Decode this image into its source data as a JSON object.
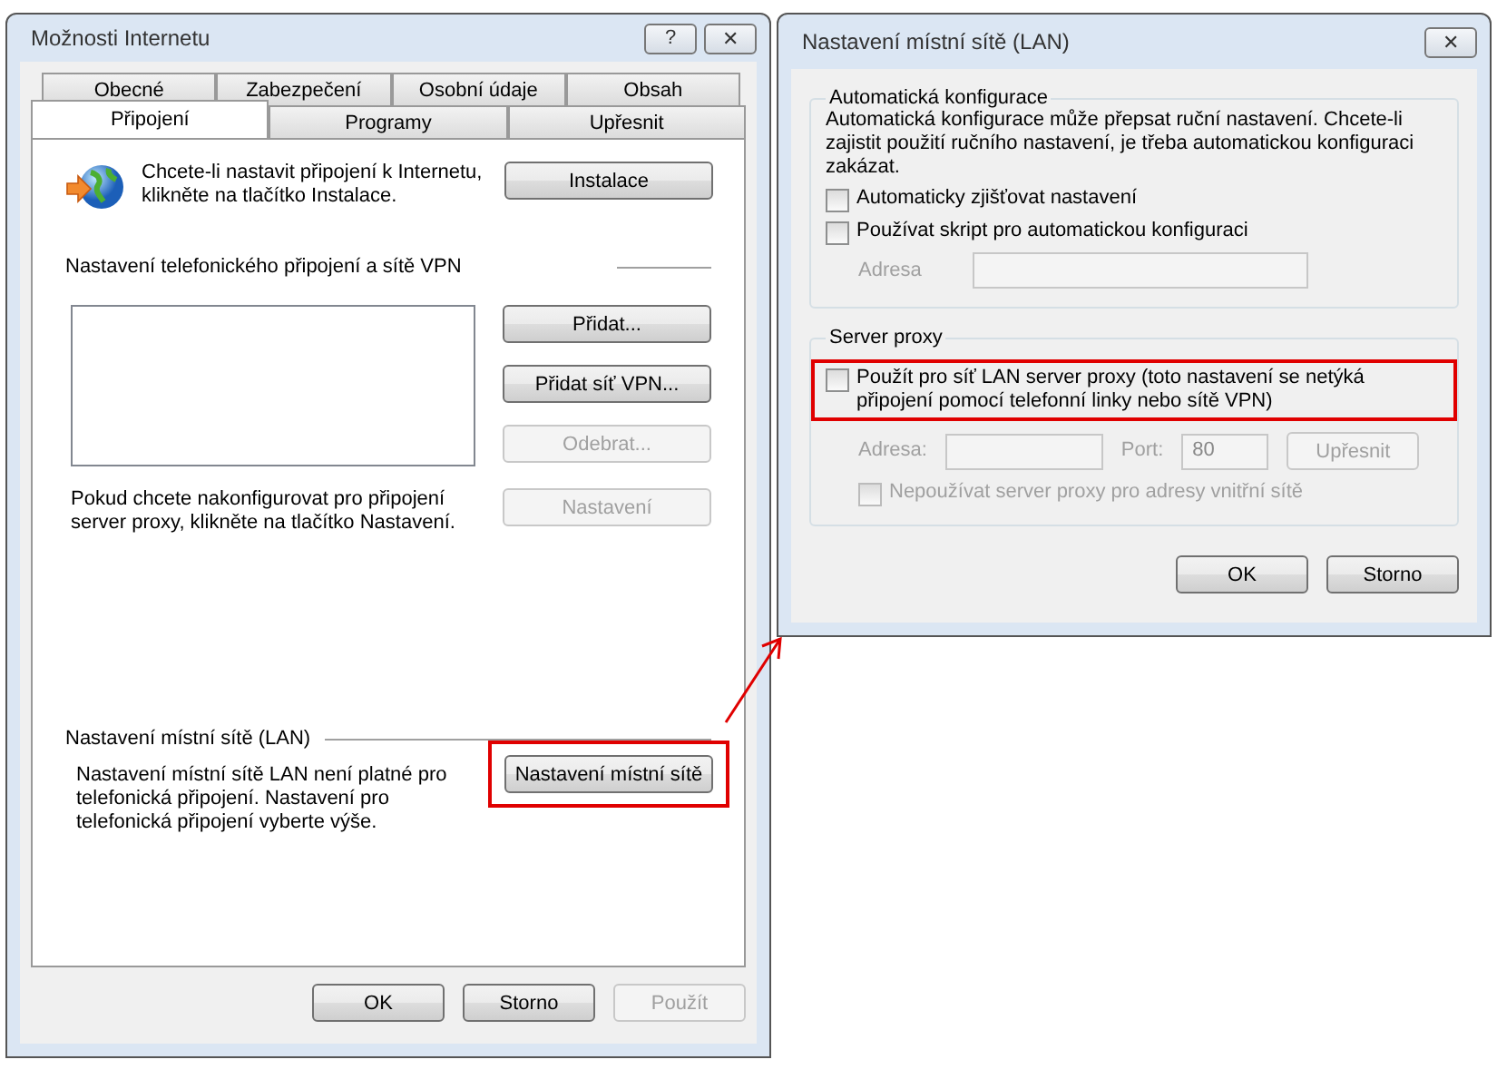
{
  "internet_options": {
    "title": "Možnosti Internetu",
    "title_buttons": [
      "?",
      "✕"
    ],
    "tab_rows": [
      [
        {
          "label": "Obecné",
          "selected": false
        },
        {
          "label": "Zabezpečení",
          "selected": false
        },
        {
          "label": "Osobní údaje",
          "selected": false
        },
        {
          "label": "Obsah",
          "selected": false
        }
      ],
      [
        {
          "label": "Připojení",
          "selected": true
        },
        {
          "label": "Programy",
          "selected": false
        },
        {
          "label": "Upřesnit",
          "selected": false
        }
      ]
    ],
    "setup": {
      "text": "Chcete-li nastavit připojení k Internetu, klikněte na tlačítko Instalace.",
      "button": {
        "label": "Instalace",
        "disabled": false,
        "highlighted": false
      }
    },
    "dialup": {
      "heading": "Nastavení telefonického připojení a sítě VPN",
      "buttons": [
        {
          "label": "Přidat...",
          "disabled": false,
          "highlighted": false
        },
        {
          "label": "Přidat síť VPN...",
          "disabled": false,
          "highlighted": false
        },
        {
          "label": "Odebrat...",
          "disabled": true,
          "highlighted": false
        }
      ],
      "proxy_text": "Pokud chcete nakonfigurovat pro připojení server proxy, klikněte na tlačítko Nastavení.",
      "settings_button": {
        "label": "Nastavení",
        "disabled": true,
        "highlighted": false
      }
    },
    "lan": {
      "heading": "Nastavení místní sítě (LAN)",
      "text": "Nastavení místní sítě LAN není platné pro telefonická připojení. Nastavení pro telefonická připojení vyberte výše.",
      "button": {
        "label": "Nastavení místní sítě",
        "disabled": false,
        "highlighted": true
      }
    },
    "footer_buttons": [
      {
        "label": "OK",
        "disabled": false,
        "highlighted": false
      },
      {
        "label": "Storno",
        "disabled": false,
        "highlighted": false
      },
      {
        "label": "Použít",
        "disabled": true,
        "highlighted": false
      }
    ]
  },
  "lan_dialog": {
    "title": "Nastavení místní sítě (LAN)",
    "title_buttons": [
      "✕"
    ],
    "auto_group": {
      "title": "Automatická konfigurace",
      "text": "Automatická konfigurace může přepsat ruční nastavení. Chcete-li zajistit použití ručního nastavení, je třeba automatickou konfiguraci zakázat.",
      "checkboxes": [
        {
          "label": "Automaticky zjišťovat nastavení",
          "checked": false,
          "disabled": false,
          "highlighted": false
        },
        {
          "label": "Používat skript pro automatickou konfiguraci",
          "checked": false,
          "disabled": false,
          "highlighted": false
        }
      ],
      "address_label": "Adresa",
      "address_disabled": true
    },
    "proxy_group": {
      "title": "Server proxy",
      "use_proxy": {
        "label": "Použít pro síť LAN server proxy (toto nastavení se netýká připojení pomocí telefonní linky nebo sítě VPN)",
        "checked": false,
        "disabled": false,
        "highlighted": true
      },
      "address_label": "Adresa:",
      "port_label": "Port:",
      "port_value": "80",
      "fields_disabled": true,
      "advanced_button": {
        "label": "Upřesnit",
        "disabled": true,
        "highlighted": false
      },
      "bypass": {
        "label": "Nepoužívat server proxy pro adresy vnitřní sítě",
        "checked": false,
        "disabled": true,
        "highlighted": false
      }
    },
    "buttons": [
      {
        "label": "OK",
        "disabled": false,
        "highlighted": false
      },
      {
        "label": "Storno",
        "disabled": false,
        "highlighted": false
      }
    ]
  }
}
